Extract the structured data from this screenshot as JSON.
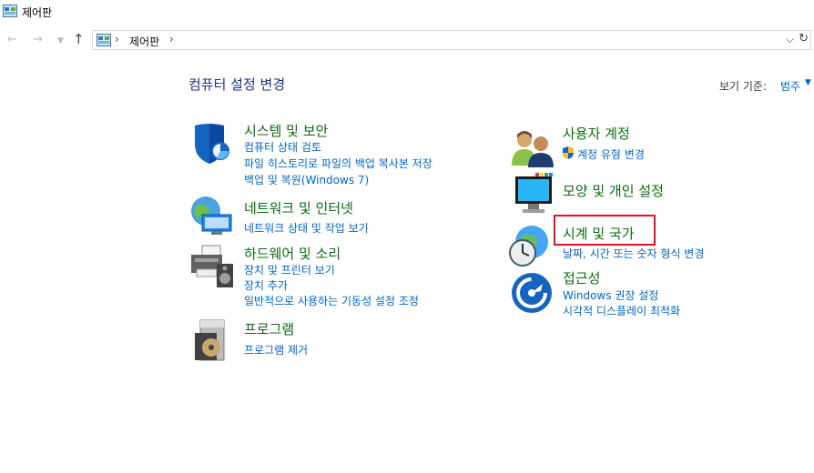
{
  "window": {
    "title": "제어판"
  },
  "nav": {
    "back_icon": "back-arrow-icon",
    "forward_icon": "forward-arrow-icon",
    "recent_icon": "chevron-down-icon",
    "up_icon": "up-arrow-icon",
    "address": {
      "path_item": "제어판",
      "sep1": "›",
      "sep2": "›"
    },
    "dropdown_glyph": "⌵",
    "refresh_glyph": "↻"
  },
  "header": {
    "title": "컴퓨터 설정 변경",
    "view_by_label": "보기 기준:",
    "view_by_value": "범주"
  },
  "categories": {
    "system": {
      "title": "시스템 및 보안",
      "links": [
        "컴퓨터 상태 검토",
        "파일 히스토리로 파일의 백업 복사본 저장",
        "백업 및 복원(Windows 7)"
      ]
    },
    "network": {
      "title": "네트워크 및 인터넷",
      "links": [
        "네트워크 상태 및 작업 보기"
      ]
    },
    "hardware": {
      "title": "하드웨어 및 소리",
      "links": [
        "장치 및 프린터 보기",
        "장치 추가",
        "일반적으로 사용하는 기동성 설정 조정"
      ]
    },
    "programs": {
      "title": "프로그램",
      "links": [
        "프로그램 제거"
      ]
    },
    "accounts": {
      "title": "사용자 계정",
      "links": [
        "계정 유형 변경"
      ]
    },
    "appearance": {
      "title": "모양 및 개인 설정",
      "links": []
    },
    "clock": {
      "title": "시계 및 국가",
      "links": [
        "날짜, 시간 또는 숫자 형식 변경"
      ]
    },
    "ease": {
      "title": "접근성",
      "links": [
        "Windows 권장 설정",
        "시각적 디스플레이 최적화"
      ]
    }
  },
  "colors": {
    "title_blue": "#1e3287",
    "category_green": "#0e6b0e",
    "link_blue": "#0066cc",
    "highlight_red": "#e81123"
  }
}
